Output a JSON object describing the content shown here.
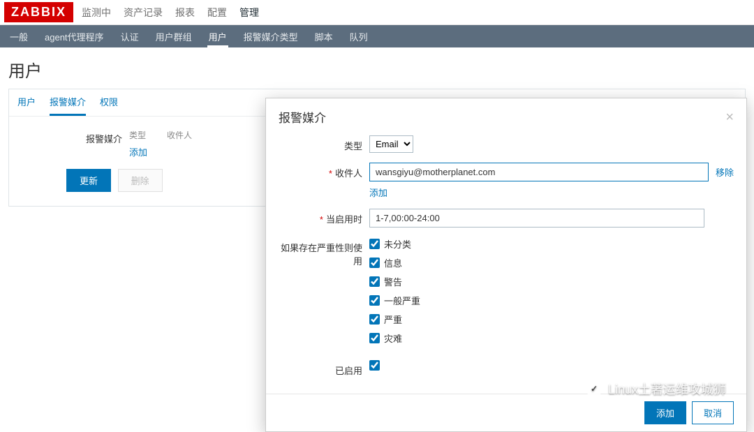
{
  "logo": "ZABBIX",
  "topmenu": {
    "items": [
      {
        "label": "监测中"
      },
      {
        "label": "资产记录"
      },
      {
        "label": "报表"
      },
      {
        "label": "配置"
      },
      {
        "label": "管理"
      }
    ]
  },
  "submenu": {
    "items": [
      {
        "label": "一般"
      },
      {
        "label": "agent代理程序"
      },
      {
        "label": "认证"
      },
      {
        "label": "用户群组"
      },
      {
        "label": "用户"
      },
      {
        "label": "报警媒介类型"
      },
      {
        "label": "脚本"
      },
      {
        "label": "队列"
      }
    ]
  },
  "page_title": "用户",
  "tabs": {
    "items": [
      {
        "label": "用户"
      },
      {
        "label": "报警媒介"
      },
      {
        "label": "权限"
      }
    ]
  },
  "main_form": {
    "label": "报警媒介",
    "col_type": "类型",
    "col_recipient": "收件人",
    "add_link": "添加",
    "update_btn": "更新",
    "delete_btn": "删除"
  },
  "modal": {
    "title": "报警媒介",
    "labels": {
      "type": "类型",
      "recipient": "收件人",
      "when_active": "当启用时",
      "use_if_severity": "如果存在严重性则使用",
      "enabled": "已启用"
    },
    "type_value": "Email",
    "recipient_value": "wansgiyu@motherplanet.com",
    "remove_link": "移除",
    "add_link": "添加",
    "when_active_value": "1-7,00:00-24:00",
    "severities": [
      {
        "label": "未分类",
        "checked": true
      },
      {
        "label": "信息",
        "checked": true
      },
      {
        "label": "警告",
        "checked": true
      },
      {
        "label": "一般严重",
        "checked": true
      },
      {
        "label": "严重",
        "checked": true
      },
      {
        "label": "灾难",
        "checked": true
      }
    ],
    "enabled_checked": true,
    "btn_add": "添加",
    "btn_cancel": "取消"
  },
  "watermark": "Linux土著运维攻城狮"
}
